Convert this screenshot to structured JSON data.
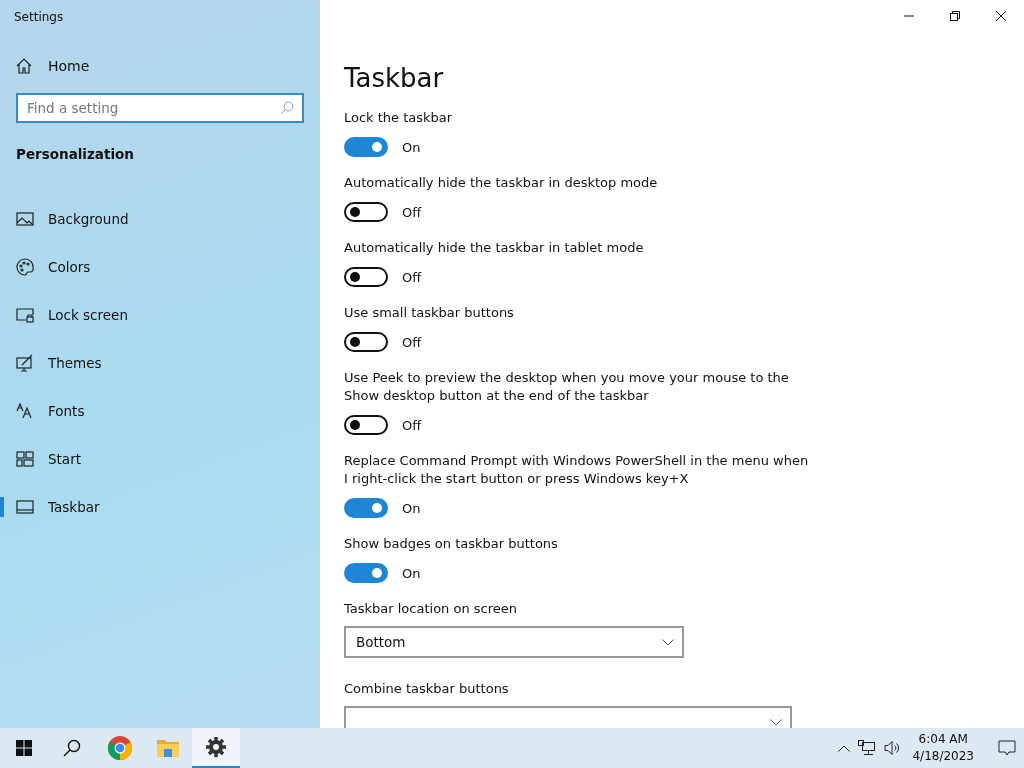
{
  "window": {
    "title": "Settings"
  },
  "sidebar": {
    "home": "Home",
    "search": {
      "placeholder": "Find a setting"
    },
    "section": "Personalization",
    "items": [
      {
        "label": "Background",
        "selected": false
      },
      {
        "label": "Colors",
        "selected": false
      },
      {
        "label": "Lock screen",
        "selected": false
      },
      {
        "label": "Themes",
        "selected": false
      },
      {
        "label": "Fonts",
        "selected": false
      },
      {
        "label": "Start",
        "selected": false
      },
      {
        "label": "Taskbar",
        "selected": true
      }
    ]
  },
  "page": {
    "title": "Taskbar"
  },
  "settings": [
    {
      "kind": "toggle",
      "label": "Lock the taskbar",
      "on": true,
      "state_label": "On"
    },
    {
      "kind": "toggle",
      "label": "Automatically hide the taskbar in desktop mode",
      "on": false,
      "state_label": "Off"
    },
    {
      "kind": "toggle",
      "label": "Automatically hide the taskbar in tablet mode",
      "on": false,
      "state_label": "Off"
    },
    {
      "kind": "toggle",
      "label": "Use small taskbar buttons",
      "on": false,
      "state_label": "Off"
    },
    {
      "kind": "toggle",
      "label": "Use Peek to preview the desktop when you move your mouse to the Show desktop button at the end of the taskbar",
      "on": false,
      "state_label": "Off"
    },
    {
      "kind": "toggle",
      "label": "Replace Command Prompt with Windows PowerShell in the menu when I right-click the start button or press Windows key+X",
      "on": true,
      "state_label": "On"
    },
    {
      "kind": "toggle",
      "label": "Show badges on taskbar buttons",
      "on": true,
      "state_label": "On"
    },
    {
      "kind": "dropdown",
      "label": "Taskbar location on screen",
      "value": "Bottom"
    },
    {
      "kind": "dropdown",
      "label": "Combine taskbar buttons"
    }
  ],
  "taskbar": {
    "apps": [
      {
        "selected": false
      },
      {
        "selected": false
      },
      {
        "selected": false
      },
      {
        "selected": false
      },
      {
        "selected": true
      }
    ],
    "time": "6:04 AM",
    "date": "4/18/2023"
  }
}
